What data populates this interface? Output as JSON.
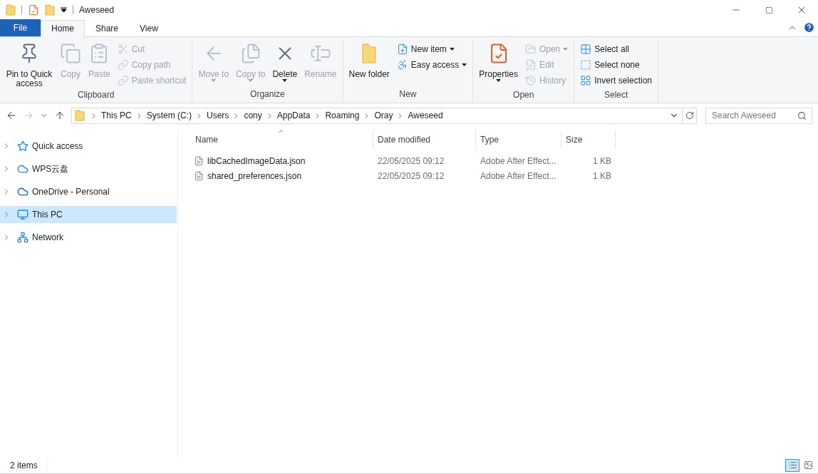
{
  "window": {
    "title": "Aweseed"
  },
  "tabs": [
    {
      "label": "File",
      "kind": "file",
      "selected": false
    },
    {
      "label": "Home",
      "kind": "tab",
      "selected": true
    },
    {
      "label": "Share",
      "kind": "tab",
      "selected": false
    },
    {
      "label": "View",
      "kind": "tab",
      "selected": false
    }
  ],
  "ribbon": [
    {
      "label": "Clipboard",
      "columns": [
        [
          {
            "label": "Pin to Quick access",
            "kind": "large",
            "disabled": false,
            "dropdown": false
          }
        ],
        [
          {
            "label": "Copy",
            "kind": "large",
            "disabled": true,
            "dropdown": false
          }
        ],
        [
          {
            "label": "Paste",
            "kind": "large",
            "disabled": true,
            "dropdown": false
          }
        ],
        [
          {
            "label": "Cut",
            "kind": "small",
            "disabled": true,
            "dropdown": false
          },
          {
            "label": "Copy path",
            "kind": "small",
            "disabled": true,
            "dropdown": false
          },
          {
            "label": "Paste shortcut",
            "kind": "small",
            "disabled": true,
            "dropdown": false
          }
        ]
      ]
    },
    {
      "label": "Organize",
      "columns": [
        [
          {
            "label": "Move to",
            "kind": "large",
            "disabled": true,
            "dropdown": true
          }
        ],
        [
          {
            "label": "Copy to",
            "kind": "large",
            "disabled": true,
            "dropdown": true
          }
        ],
        [
          {
            "label": "Delete",
            "kind": "large",
            "disabled": false,
            "dropdown": true
          }
        ],
        [
          {
            "label": "Rename",
            "kind": "large",
            "disabled": true,
            "dropdown": false
          }
        ]
      ]
    },
    {
      "label": "New",
      "columns": [
        [
          {
            "label": "New folder",
            "kind": "large",
            "disabled": false,
            "dropdown": false
          }
        ],
        [
          {
            "label": "New item",
            "kind": "small",
            "disabled": false,
            "dropdown": true
          },
          {
            "label": "Easy access",
            "kind": "small",
            "disabled": false,
            "dropdown": true
          }
        ]
      ]
    },
    {
      "label": "Open",
      "columns": [
        [
          {
            "label": "Properties",
            "kind": "large",
            "disabled": false,
            "dropdown": true
          }
        ],
        [
          {
            "label": "Open",
            "kind": "small",
            "disabled": true,
            "dropdown": true
          },
          {
            "label": "Edit",
            "kind": "small",
            "disabled": true,
            "dropdown": false
          },
          {
            "label": "History",
            "kind": "small",
            "disabled": true,
            "dropdown": false
          }
        ]
      ]
    },
    {
      "label": "Select",
      "columns": [
        [
          {
            "label": "Select all",
            "kind": "small",
            "disabled": false,
            "dropdown": false
          },
          {
            "label": "Select none",
            "kind": "small",
            "disabled": false,
            "dropdown": false
          },
          {
            "label": "Invert selection",
            "kind": "small",
            "disabled": false,
            "dropdown": false
          }
        ]
      ]
    }
  ],
  "address": {
    "path": [
      "This PC",
      "System (C:)",
      "Users",
      "cony",
      "AppData",
      "Roaming",
      "Oray",
      "Aweseed"
    ]
  },
  "search": {
    "placeholder": "Search Aweseed"
  },
  "sidebar": {
    "items": [
      {
        "label": "Quick access",
        "selected": false
      },
      {
        "label": "WPS云盘",
        "selected": false
      },
      {
        "label": "OneDrive - Personal",
        "selected": false
      },
      {
        "label": "This PC",
        "selected": true
      },
      {
        "label": "Network",
        "selected": false
      }
    ]
  },
  "table": {
    "columns": [
      "Name",
      "Date modified",
      "Type",
      "Size"
    ],
    "rows": [
      {
        "name": "libCachedImageData.json",
        "date": "22/05/2025 09:12",
        "type": "Adobe After Effect...",
        "size": "1 KB"
      },
      {
        "name": "shared_preferences.json",
        "date": "22/05/2025 09:12",
        "type": "Adobe After Effect...",
        "size": "1 KB"
      }
    ]
  },
  "status_bar": {
    "count": "2 items"
  },
  "views": [
    {
      "kind": "details",
      "selected": true
    },
    {
      "kind": "tiles",
      "selected": false
    }
  ]
}
